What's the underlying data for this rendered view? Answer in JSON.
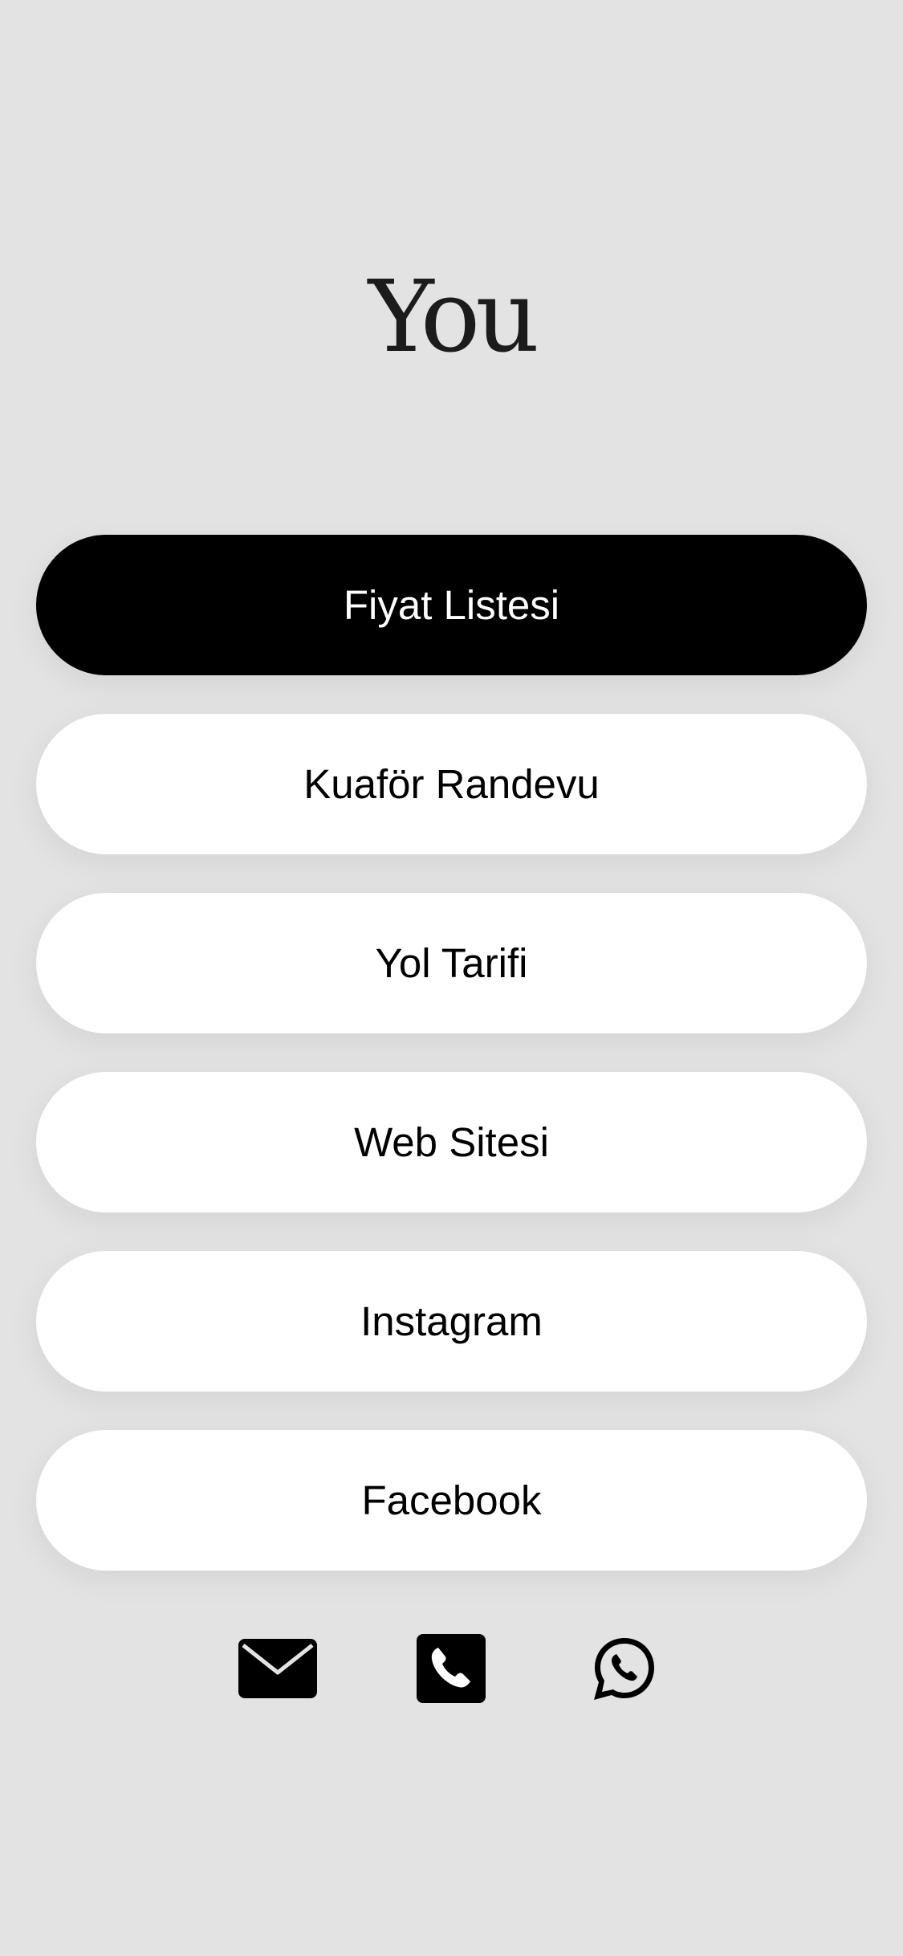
{
  "header": {
    "logo_text": "You"
  },
  "links": [
    {
      "label": "Fiyat Listesi",
      "primary": true
    },
    {
      "label": "Kuaför Randevu",
      "primary": false
    },
    {
      "label": "Yol Tarifi",
      "primary": false
    },
    {
      "label": "Web Sitesi",
      "primary": false
    },
    {
      "label": "Instagram",
      "primary": false
    },
    {
      "label": "Facebook",
      "primary": false
    }
  ],
  "contact": {
    "icons": [
      "mail-icon",
      "phone-icon",
      "whatsapp-icon"
    ]
  },
  "colors": {
    "background": "#e3e3e3",
    "primary_button": "#000000",
    "secondary_button": "#ffffff",
    "logo": "#1c1c1c"
  }
}
